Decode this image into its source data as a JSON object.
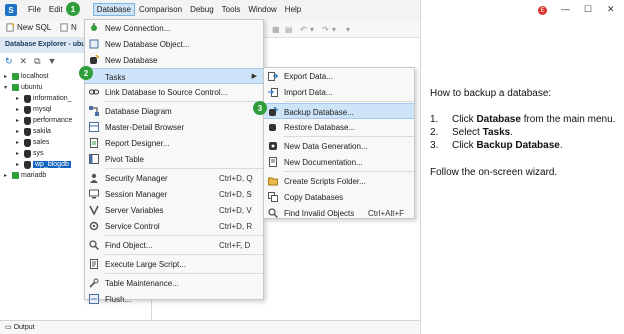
{
  "menubar": {
    "items": [
      "File",
      "Edit",
      "Database",
      "Comparison",
      "Debug",
      "Tools",
      "Window",
      "Help"
    ],
    "active": "Database"
  },
  "window": {
    "user_initial": "E",
    "minimize": "—",
    "maximize": "☐",
    "close": "✕"
  },
  "steps": [
    "1",
    "2",
    "3"
  ],
  "toolbar": {
    "new_sql": "New SQL",
    "n_cut": "N"
  },
  "explorer": {
    "header": "Database Explorer - ubu",
    "nodes": [
      {
        "label": "localhost",
        "kind": "server",
        "expanded": false
      },
      {
        "label": "ubuntu",
        "kind": "server",
        "expanded": true
      },
      {
        "label": "information_",
        "kind": "database",
        "expanded": false
      },
      {
        "label": "mysql",
        "kind": "database",
        "expanded": false
      },
      {
        "label": "performance",
        "kind": "database",
        "expanded": false
      },
      {
        "label": "sakila",
        "kind": "database",
        "expanded": false
      },
      {
        "label": "sales",
        "kind": "database",
        "expanded": false
      },
      {
        "label": "sys",
        "kind": "database",
        "expanded": false
      },
      {
        "label": "wp_blogdb",
        "kind": "database",
        "expanded": false,
        "selected": true
      },
      {
        "label": "mariadb",
        "kind": "server",
        "expanded": false
      }
    ]
  },
  "database_menu": {
    "items": [
      {
        "label": "New Connection...",
        "shortcut": "",
        "icon": "new-connection-icon"
      },
      {
        "label": "New Database Object...",
        "shortcut": "",
        "icon": "new-object-icon"
      },
      {
        "label": "New Database",
        "shortcut": "",
        "icon": "new-database-icon"
      },
      {
        "label": "Tasks",
        "shortcut": "",
        "icon": "tasks-icon",
        "submenu": true,
        "highlighted": true
      },
      {
        "label": "Link Database to Source Control...",
        "shortcut": "",
        "icon": "link-icon"
      },
      {
        "label": "Database Diagram",
        "shortcut": "",
        "icon": "diagram-icon"
      },
      {
        "label": "Master-Detail Browser",
        "shortcut": "",
        "icon": "master-detail-icon"
      },
      {
        "label": "Report Designer...",
        "shortcut": "",
        "icon": "report-icon"
      },
      {
        "label": "Pivot Table",
        "shortcut": "",
        "icon": "pivot-icon"
      },
      {
        "label": "Security Manager",
        "shortcut": "Ctrl+D, Q",
        "icon": "security-icon"
      },
      {
        "label": "Session Manager",
        "shortcut": "Ctrl+D, S",
        "icon": "session-icon"
      },
      {
        "label": "Server Variables",
        "shortcut": "Ctrl+D, V",
        "icon": "variables-icon"
      },
      {
        "label": "Service Control",
        "shortcut": "Ctrl+D, R",
        "icon": "service-icon"
      },
      {
        "label": "Find Object...",
        "shortcut": "Ctrl+F, D",
        "icon": "find-icon"
      },
      {
        "label": "Execute Large Script...",
        "shortcut": "",
        "icon": "script-icon"
      },
      {
        "label": "Table Maintenance...",
        "shortcut": "",
        "icon": "maintenance-icon"
      },
      {
        "label": "Flush...",
        "shortcut": "",
        "icon": "flush-icon"
      }
    ]
  },
  "tasks_submenu": {
    "items": [
      {
        "label": "Export Data...",
        "shortcut": "",
        "icon": "export-icon"
      },
      {
        "label": "Import Data...",
        "shortcut": "",
        "icon": "import-icon"
      },
      {
        "label": "Backup Database...",
        "shortcut": "",
        "icon": "backup-icon",
        "highlighted": true
      },
      {
        "label": "Restore Database...",
        "shortcut": "",
        "icon": "restore-icon"
      },
      {
        "label": "New Data Generation...",
        "shortcut": "",
        "icon": "data-generation-icon"
      },
      {
        "label": "New Documentation...",
        "shortcut": "",
        "icon": "documentation-icon"
      },
      {
        "label": "Create Scripts Folder...",
        "shortcut": "",
        "icon": "scripts-folder-icon"
      },
      {
        "label": "Copy Databases",
        "shortcut": "",
        "icon": "copy-databases-icon"
      },
      {
        "label": "Find Invalid Objects",
        "shortcut": "Ctrl+Alt+F",
        "icon": "invalid-objects-icon"
      }
    ]
  },
  "instructions": {
    "heading": "How to backup a database:",
    "steps": [
      {
        "num": "1.",
        "pre": "Click ",
        "bold": "Database",
        "post": " from the main menu."
      },
      {
        "num": "2.",
        "pre": "Select ",
        "bold": "Tasks",
        "post": "."
      },
      {
        "num": "3.",
        "pre": "Click ",
        "bold": "Backup Database",
        "post": "."
      }
    ],
    "footer": "Follow the on-screen wizard."
  },
  "output_tab": "Output",
  "colors": {
    "accent": "#1565c0",
    "step_badge": "#2f9e3a",
    "menu_highlight": "#cde3f8"
  }
}
